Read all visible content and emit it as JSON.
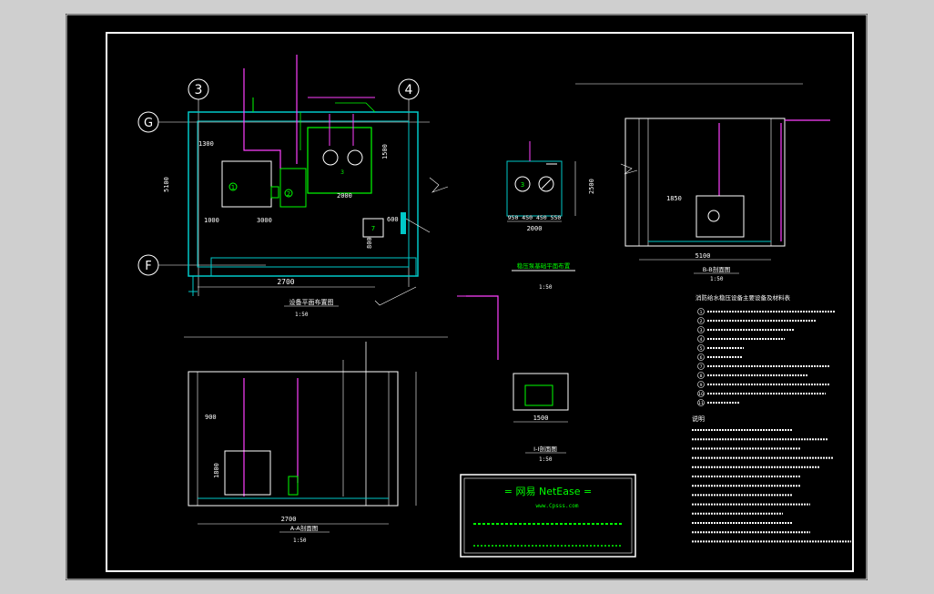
{
  "colors": {
    "background": "#000000",
    "frame": "#ffffff",
    "wall": "#00c8c8",
    "pipe": "#ff40ff",
    "accent": "#00ff00",
    "dimension": "#ffffff",
    "detail": "#ffff00"
  },
  "axes": {
    "axis_3": "3",
    "axis_4": "4",
    "axis_g": "G",
    "axis_f": "F"
  },
  "plan": {
    "dim_total_width": "2700",
    "dim_left_depth": "5100",
    "dim_1300": "1300",
    "dim_1000": "1000",
    "dim_3000": "3000",
    "dim_2000": "2000",
    "dim_600": "600",
    "dim_1500": "1500",
    "dim_800": "800",
    "marker_1": "1",
    "marker_2": "2",
    "marker_3": "3",
    "marker_7": "7",
    "title": "设备平面布置图",
    "scale": "1:50"
  },
  "pump_plan": {
    "dim_width": "2000",
    "dim_parts": "950  450  450  550",
    "dim_height": "2500",
    "marker_3": "3",
    "title": "稳压泵基础平面布置",
    "scale": "1:50"
  },
  "right_elevation": {
    "dim_width": "5100",
    "dim_1850": "1850",
    "title": "B-B剖面图",
    "scale": "1:50"
  },
  "lower_elevation": {
    "dim_width": "2700",
    "dim_900": "900",
    "dim_1800": "1800",
    "title": "A-A剖面图",
    "scale": "1:50"
  },
  "section": {
    "dim_1500": "1500",
    "title": "I-I剖面图",
    "scale": "1:50"
  },
  "legend": {
    "title": "消防给水稳压设备主要设备及材料表",
    "items": [
      {
        "num": "1"
      },
      {
        "num": "2"
      },
      {
        "num": "3"
      },
      {
        "num": "4"
      },
      {
        "num": "5"
      },
      {
        "num": "6"
      },
      {
        "num": "7"
      },
      {
        "num": "8"
      },
      {
        "num": "9"
      },
      {
        "num": "10"
      },
      {
        "num": "11"
      }
    ]
  },
  "notes": {
    "title": "说明"
  },
  "watermark": {
    "line1": "= 网易 NetEase =",
    "line2": "www.Cpsss.com"
  }
}
